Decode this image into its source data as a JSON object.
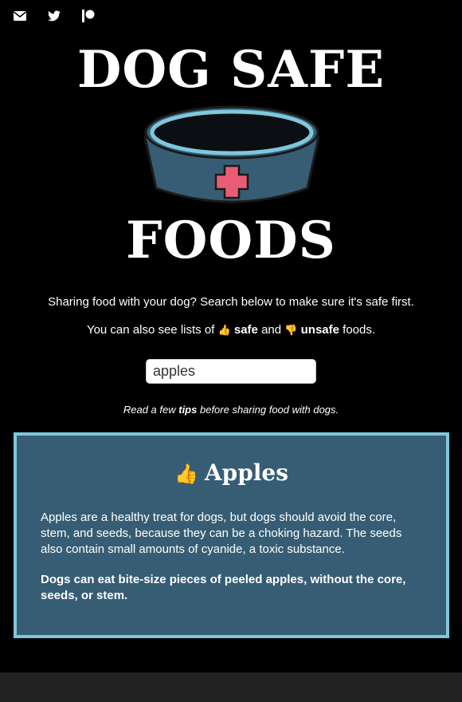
{
  "social": {
    "icons": [
      "envelope-icon",
      "twitter-icon",
      "patreon-icon"
    ]
  },
  "header": {
    "title_top": "DOG SAFE",
    "title_bottom": "FOODS"
  },
  "intro": {
    "line1": "Sharing food with your dog? Search below to make sure it's safe first.",
    "line2_prefix": "You can also see lists of",
    "safe_emoji": "👍",
    "safe_label": "safe",
    "and_word": "and",
    "unsafe_emoji": "👎",
    "unsafe_label": "unsafe",
    "line2_suffix": "foods."
  },
  "search": {
    "value": "apples",
    "placeholder": ""
  },
  "tips": {
    "prefix": "Read a few",
    "link": "tips",
    "suffix": "before sharing food with dogs."
  },
  "result": {
    "verdict_emoji": "👍",
    "name": "Apples",
    "description": "Apples are a healthy treat for dogs, but dogs should avoid the core, stem, and seeds, because they can be a choking hazard. The seeds also contain small amounts of cyanide, a toxic substance.",
    "verdict": "Dogs can eat bite-size pieces of peeled apples, without the core, seeds, or stem."
  },
  "colors": {
    "background": "#000000",
    "card_background": "#365d74",
    "card_border": "#7ec8dc",
    "footer": "#222222",
    "bowl_body": "#365d74",
    "bowl_rim": "#7ec8dc",
    "cross": "#e85d75"
  }
}
